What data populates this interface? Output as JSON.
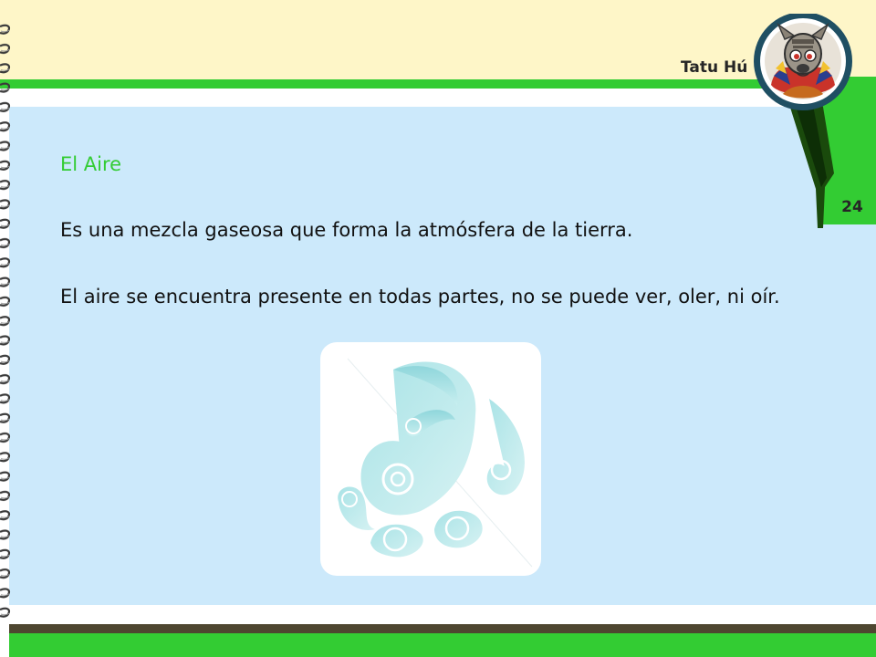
{
  "header": {
    "brand": "Tatu Hú",
    "page_number": "24"
  },
  "slide": {
    "heading": "El Aire",
    "paragraphs": [
      "Es una mezcla gaseosa que forma la atmósfera de la tierra.",
      "El aire se encuentra presente en todas partes, no se puede ver, oler, ni oír."
    ]
  },
  "icons": {
    "mascot": "armadillo-mascot-icon",
    "illustration": "wind-swirl-icon",
    "binding": "spiral-binding-icon"
  },
  "colors": {
    "accent_green": "#33cc33",
    "header_yellow": "#fef6c8",
    "content_blue": "#cce9fb",
    "footer_brown": "#4e4630",
    "heading_green": "#33cc33"
  }
}
